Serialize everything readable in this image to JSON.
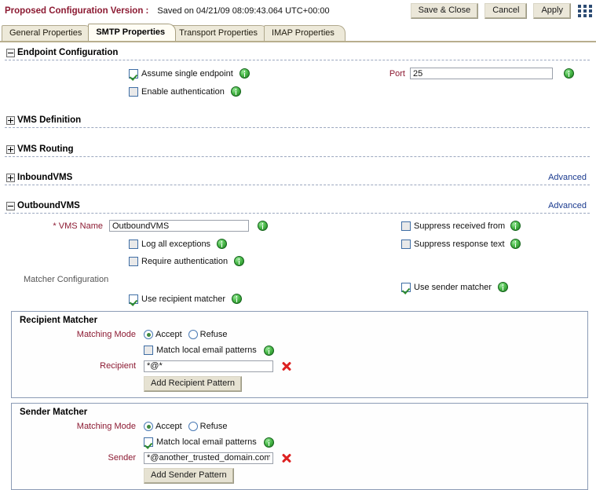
{
  "header": {
    "title": "Proposed Configuration Version :",
    "saved_text": "Saved on 04/21/09 08:09:43.064 UTC+00:00",
    "buttons": [
      {
        "label": "Save & Close",
        "name": "save-and-close-button"
      },
      {
        "label": "Cancel",
        "name": "cancel-button"
      },
      {
        "label": "Apply",
        "name": "apply-button"
      }
    ],
    "grid_icon": "grid-menu-icon",
    "title_color": "#8c1a32"
  },
  "tabs": [
    {
      "label": "General Properties",
      "active": false
    },
    {
      "label": "SMTP Properties",
      "active": true
    },
    {
      "label": "Transport Properties",
      "active": false
    },
    {
      "label": "IMAP Properties",
      "active": false
    }
  ],
  "sections": {
    "endpoint": {
      "title": "Endpoint Configuration",
      "expanded": true,
      "assume_single_endpoint": {
        "label": "Assume single endpoint",
        "checked": true
      },
      "enable_authentication": {
        "label": "Enable authentication",
        "checked": false
      },
      "port": {
        "label": "Port",
        "value": "25"
      }
    },
    "vms_definition": {
      "title": "VMS Definition",
      "expanded": false
    },
    "vms_routing": {
      "title": "VMS Routing",
      "expanded": false
    },
    "inbound_vms": {
      "title": "InboundVMS",
      "expanded": false,
      "advanced_label": "Advanced"
    },
    "outbound_vms": {
      "title": "OutboundVMS",
      "expanded": true,
      "advanced_label": "Advanced",
      "vms_name": {
        "label": "VMS Name",
        "required_marker": "*",
        "value": "OutboundVMS"
      },
      "log_all_exceptions": {
        "label": "Log all exceptions",
        "checked": false
      },
      "require_authentication": {
        "label": "Require authentication",
        "checked": false
      },
      "suppress_received_from": {
        "label": "Suppress received from",
        "checked": false
      },
      "suppress_response_text": {
        "label": "Suppress response text",
        "checked": false
      },
      "matcher_configuration_label": "Matcher Configuration",
      "use_recipient_matcher": {
        "label": "Use recipient matcher",
        "checked": true
      },
      "use_sender_matcher": {
        "label": "Use sender matcher",
        "checked": true
      }
    }
  },
  "recipient_matcher": {
    "title": "Recipient Matcher",
    "matching_mode_label": "Matching Mode",
    "accept_label": "Accept",
    "refuse_label": "Refuse",
    "mode_selected": "Accept",
    "match_local_email_patterns": {
      "label": "Match local email patterns",
      "checked": false
    },
    "pattern_label": "Recipient",
    "pattern_value": "*@*",
    "add_button_label": "Add Recipient Pattern"
  },
  "sender_matcher": {
    "title": "Sender Matcher",
    "matching_mode_label": "Matching Mode",
    "accept_label": "Accept",
    "refuse_label": "Refuse",
    "mode_selected": "Accept",
    "match_local_email_patterns": {
      "label": "Match local email patterns",
      "checked": true
    },
    "pattern_label": "Sender",
    "pattern_value": "*@another_trusted_domain.com",
    "add_button_label": "Add Sender Pattern"
  },
  "colors": {
    "accent_red": "#8c1a32",
    "link_blue": "#1a3a8f",
    "tab_active_bg": "#fffdf4",
    "tab_bg": "#ede9d9",
    "info_green": "#2e8b2e",
    "delete_red": "#dd2222"
  }
}
